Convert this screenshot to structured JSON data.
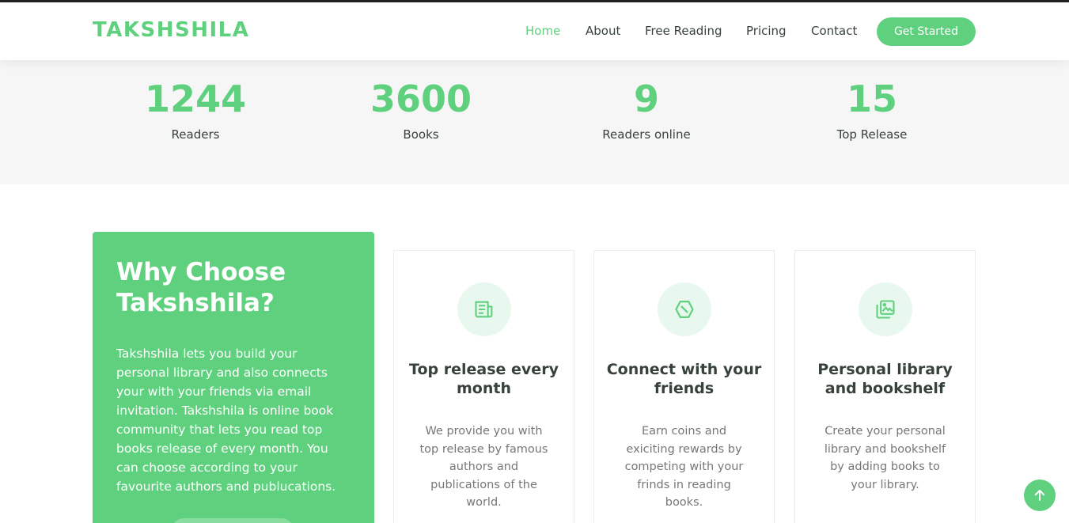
{
  "brand": {
    "name": "TAKSHSHILA",
    "accent": "#5fd17e"
  },
  "nav": {
    "items": [
      "Home",
      "About",
      "Free Reading",
      "Pricing",
      "Contact"
    ],
    "active": "Home",
    "cta_label": "Get Started"
  },
  "stats": [
    {
      "value": "1244",
      "label": "Readers"
    },
    {
      "value": "3600",
      "label": "Books"
    },
    {
      "value": "9",
      "label": "Readers online"
    },
    {
      "value": "15",
      "label": "Top Release"
    }
  ],
  "why": {
    "title": "Why Choose Takshshila?",
    "text": "Takshshila lets you build your personal library and also connects your with your friends via email invitation. Takshshila is online book community that lets you read top books release of every month. You can choose according to your favourite authors and publucations."
  },
  "features": [
    {
      "icon": "newspaper-icon",
      "title": "Top release every month",
      "text": "We provide you with top release by famous authors and publications of the world."
    },
    {
      "icon": "hexagon-icon",
      "title": "Connect with your friends",
      "text": "Earn coins and exiciting rewards by competing with your frinds in reading books."
    },
    {
      "icon": "images-icon",
      "title": "Personal library and bookshelf",
      "text": "Create your personal library and bookshelf by adding books to your library."
    }
  ],
  "back_to_top_icon": "arrow-up-icon"
}
